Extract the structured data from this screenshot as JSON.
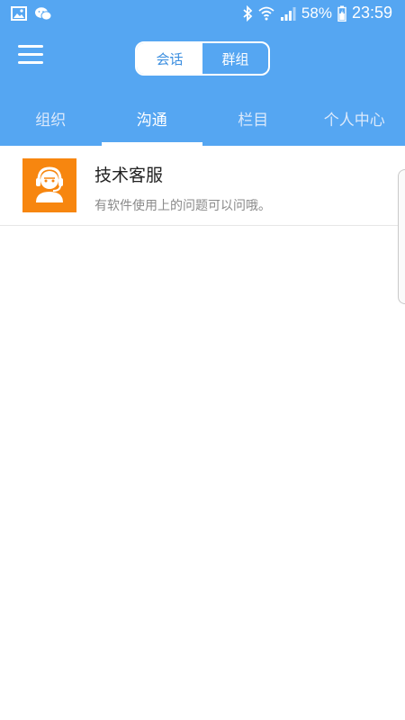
{
  "status_bar": {
    "left_icons": [
      "image-icon",
      "wechat-icon"
    ],
    "right_icons": [
      "bluetooth-icon",
      "wifi-icon",
      "signal-icon",
      "battery-icon"
    ],
    "battery_percent": "58%",
    "time": "23:59"
  },
  "header": {
    "menu_icon": "hamburger-menu-icon",
    "segments": [
      {
        "label": "会话",
        "active": true
      },
      {
        "label": "群组",
        "active": false
      }
    ]
  },
  "tabs": [
    {
      "label": "组织",
      "active": false
    },
    {
      "label": "沟通",
      "active": true
    },
    {
      "label": "栏目",
      "active": false
    },
    {
      "label": "个人中心",
      "active": false
    }
  ],
  "conversations": [
    {
      "title": "技术客服",
      "subtitle": "有软件使用上的问题可以问哦。",
      "avatar_icon": "customer-service-headset-icon",
      "avatar_color": "#f7860f"
    }
  ],
  "colors": {
    "primary": "#55a6f2",
    "accent": "#3d8fe0"
  }
}
